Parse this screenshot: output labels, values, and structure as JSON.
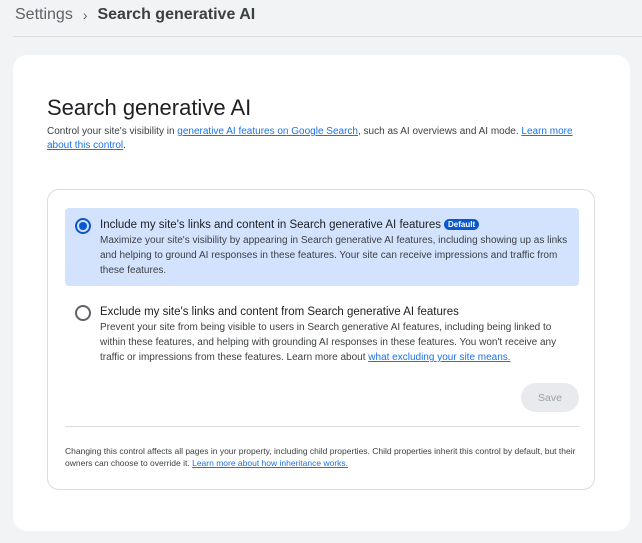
{
  "breadcrumb": {
    "parent": "Settings",
    "separator": "›",
    "current": "Search generative AI"
  },
  "page": {
    "title": "Search generative AI",
    "desc_pre": "Control your site's visibility in ",
    "desc_link": "generative AI features on Google Search",
    "desc_mid": ", such as AI overviews and AI mode. ",
    "desc_link2": "Learn more about this control",
    "desc_end": "."
  },
  "options": [
    {
      "title": "Include my site's links and content in Search generative AI features",
      "badge": "Default",
      "description": "Maximize your site's visibility by appearing in Search generative AI features, including showing up as links and helping to ground AI responses in these features. Your site can receive impressions and traffic from these features.",
      "selected": true
    },
    {
      "title": "Exclude my site's links and content from Search generative AI features",
      "description": "Prevent your site from being visible to users in Search generative AI features, including being linked to within these features, and helping with grounding AI responses in these features. You won't receive any traffic or impressions from these features. Learn more about ",
      "link": "what excluding your site means.",
      "selected": false
    }
  ],
  "save_label": "Save",
  "footer": {
    "text": "Changing this control affects all pages in your property, including child properties. Child properties inherit this control by default, but their owners can choose to override it. ",
    "link": "Learn more about how inheritance works."
  },
  "colors": {
    "accent": "#0b57d0",
    "selected_bg": "#d3e3fd",
    "link": "#1a73e8"
  }
}
